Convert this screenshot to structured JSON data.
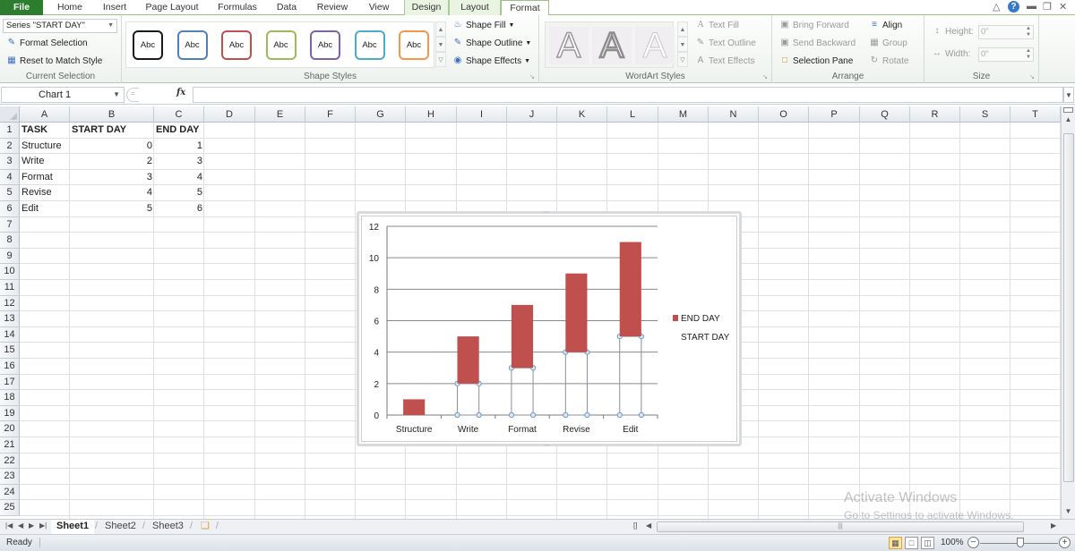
{
  "ribbon": {
    "tabs": [
      {
        "label": "File",
        "type": "file"
      },
      {
        "label": "Home"
      },
      {
        "label": "Insert"
      },
      {
        "label": "Page Layout"
      },
      {
        "label": "Formulas"
      },
      {
        "label": "Data"
      },
      {
        "label": "Review"
      },
      {
        "label": "View"
      },
      {
        "label": "Design",
        "contextual": true
      },
      {
        "label": "Layout",
        "contextual": true
      },
      {
        "label": "Format",
        "contextual": true,
        "active": true
      }
    ],
    "current_selection": {
      "selected_element": "Series \"START DAY\"",
      "format_selection": "Format Selection",
      "reset_to_match_style": "Reset to Match Style",
      "label": "Current Selection"
    },
    "shape_styles": {
      "label": "Shape Styles",
      "swatches": [
        {
          "text": "Abc",
          "color": "#1a1a1a"
        },
        {
          "text": "Abc",
          "color": "#4f81bd"
        },
        {
          "text": "Abc",
          "color": "#c0504d"
        },
        {
          "text": "Abc",
          "color": "#9bbb59"
        },
        {
          "text": "Abc",
          "color": "#8064a2"
        },
        {
          "text": "Abc",
          "color": "#4bacc6"
        },
        {
          "text": "Abc",
          "color": "#f79646"
        }
      ],
      "shape_fill": "Shape Fill",
      "shape_outline": "Shape Outline",
      "shape_effects": "Shape Effects"
    },
    "wordart_styles": {
      "label": "WordArt Styles",
      "letter": "A",
      "text_fill": "Text Fill",
      "text_outline": "Text Outline",
      "text_effects": "Text Effects"
    },
    "arrange": {
      "label": "Arrange",
      "bring_forward": "Bring Forward",
      "send_backward": "Send Backward",
      "selection_pane": "Selection Pane",
      "align": "Align",
      "group": "Group",
      "rotate": "Rotate"
    },
    "size": {
      "label": "Size",
      "height_label": "Height:",
      "height_value": "0\"",
      "width_label": "Width:",
      "width_value": "0\""
    }
  },
  "formula_bar": {
    "name_box": "Chart 1",
    "fx": "fx",
    "formula": ""
  },
  "grid": {
    "columns": [
      "A",
      "B",
      "C",
      "D",
      "E",
      "F",
      "G",
      "H",
      "I",
      "J",
      "K",
      "L",
      "M",
      "N",
      "O",
      "P",
      "Q",
      "R",
      "S",
      "T"
    ],
    "rows": [
      "1",
      "2",
      "3",
      "4",
      "5",
      "6",
      "7",
      "8",
      "9",
      "10",
      "11",
      "12",
      "13",
      "14",
      "15",
      "16",
      "17",
      "18",
      "19",
      "20",
      "21",
      "22",
      "23",
      "24",
      "25"
    ],
    "cells": {
      "header": [
        "TASK",
        "START DAY",
        "END DAY"
      ],
      "data": [
        [
          "Structure",
          "0",
          "1"
        ],
        [
          "Write",
          "2",
          "3"
        ],
        [
          "Format",
          "3",
          "4"
        ],
        [
          "Revise",
          "4",
          "5"
        ],
        [
          "Edit",
          "5",
          "6"
        ]
      ]
    }
  },
  "chart_data": {
    "type": "bar",
    "stacked": true,
    "categories": [
      "Structure",
      "Write",
      "Format",
      "Revise",
      "Edit"
    ],
    "series": [
      {
        "name": "START DAY",
        "values": [
          0,
          2,
          3,
          4,
          5
        ],
        "fill": "none",
        "selected": true
      },
      {
        "name": "END DAY",
        "values": [
          1,
          3,
          4,
          5,
          6
        ],
        "fill": "#c0504d"
      }
    ],
    "yticks": [
      "0",
      "2",
      "4",
      "6",
      "8",
      "10",
      "12"
    ],
    "ylim": [
      0,
      12
    ],
    "grid": true,
    "legend": "right",
    "legend_entries": [
      "END DAY",
      "START DAY"
    ],
    "title": "",
    "xlabel": "",
    "ylabel": ""
  },
  "sheets": {
    "tabs": [
      "Sheet1",
      "Sheet2",
      "Sheet3"
    ],
    "active": "Sheet1"
  },
  "status": {
    "ready": "Ready",
    "zoom": "100%",
    "watermark_title": "Activate Windows",
    "watermark_sub": "Go to Settings to activate Windows."
  }
}
